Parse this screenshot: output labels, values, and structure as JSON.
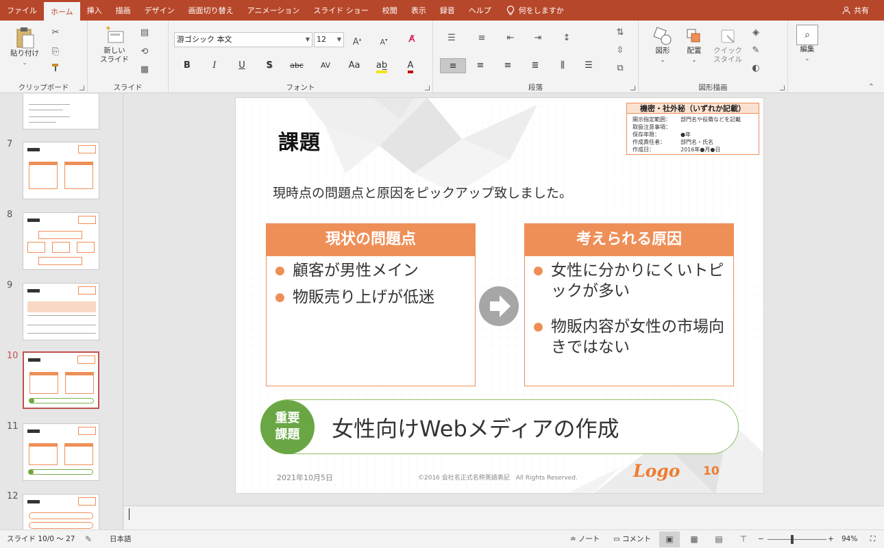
{
  "tabs": [
    "ファイル",
    "ホーム",
    "挿入",
    "描画",
    "デザイン",
    "画面切り替え",
    "アニメーション",
    "スライド ショー",
    "校閲",
    "表示",
    "録音",
    "ヘルプ"
  ],
  "active_tab": "ホーム",
  "tell_me": "何をしますか",
  "share": "共有",
  "ribbon": {
    "clipboard": {
      "paste": "貼り付け",
      "label": "クリップボード"
    },
    "slides": {
      "new_slide": "新しい\nスライド",
      "label": "スライド"
    },
    "font": {
      "name": "游ゴシック 本文",
      "size": "12",
      "label": "フォント",
      "bold": "B",
      "italic": "I",
      "underline": "U",
      "shadow": "S",
      "strike": "abc",
      "spacing": "AV",
      "case": "Aa"
    },
    "paragraph": {
      "label": "段落"
    },
    "drawing": {
      "shapes": "図形",
      "arrange": "配置",
      "quick_styles": "クイック\nスタイル",
      "label": "図形描画"
    },
    "editing": {
      "label": "編集"
    }
  },
  "thumbnails": [
    {
      "num": "7"
    },
    {
      "num": "8"
    },
    {
      "num": "9"
    },
    {
      "num": "10",
      "selected": true
    },
    {
      "num": "11"
    },
    {
      "num": "12"
    }
  ],
  "slide": {
    "title": "課題",
    "confidential": {
      "header": "機密・社外秘（いずれか記載）",
      "rows": [
        {
          "k": "開示指定範囲：",
          "v": "部門名や役職などを記載"
        },
        {
          "k": "取扱注意事項：",
          "v": ""
        },
        {
          "k": "保存年限：",
          "v": "●年"
        },
        {
          "k": "作成責任者：",
          "v": "部門名・氏名"
        },
        {
          "k": "作成日：",
          "v": "2016年●月●日"
        }
      ]
    },
    "lead": "現時点の問題点と原因をピックアップ致しました。",
    "left_box": {
      "title": "現状の問題点",
      "items": [
        "顧客が男性メイン",
        "物販売り上げが低迷"
      ]
    },
    "right_box": {
      "title": "考えられる原因",
      "items": [
        "女性に分かりにくいトピックが多い",
        "物販内容が女性の市場向きではない"
      ]
    },
    "key_badge_line1": "重要",
    "key_badge_line2": "課題",
    "key_text": "女性向けWebメディアの作成",
    "footer_date": "2021年10月5日",
    "footer_copyright": "©2016 会社名正式名称英語表記　All Rights Reserved.",
    "footer_logo": "Logo",
    "page_number": "10"
  },
  "status": {
    "slide_info": "スライド 10/0 ～ 27",
    "language": "日本語",
    "notes": "ノート",
    "comments": "コメント",
    "zoom": "94%"
  },
  "colors": {
    "accent": "#b7472a",
    "orange": "#ee8f58",
    "green": "#6aa744"
  }
}
